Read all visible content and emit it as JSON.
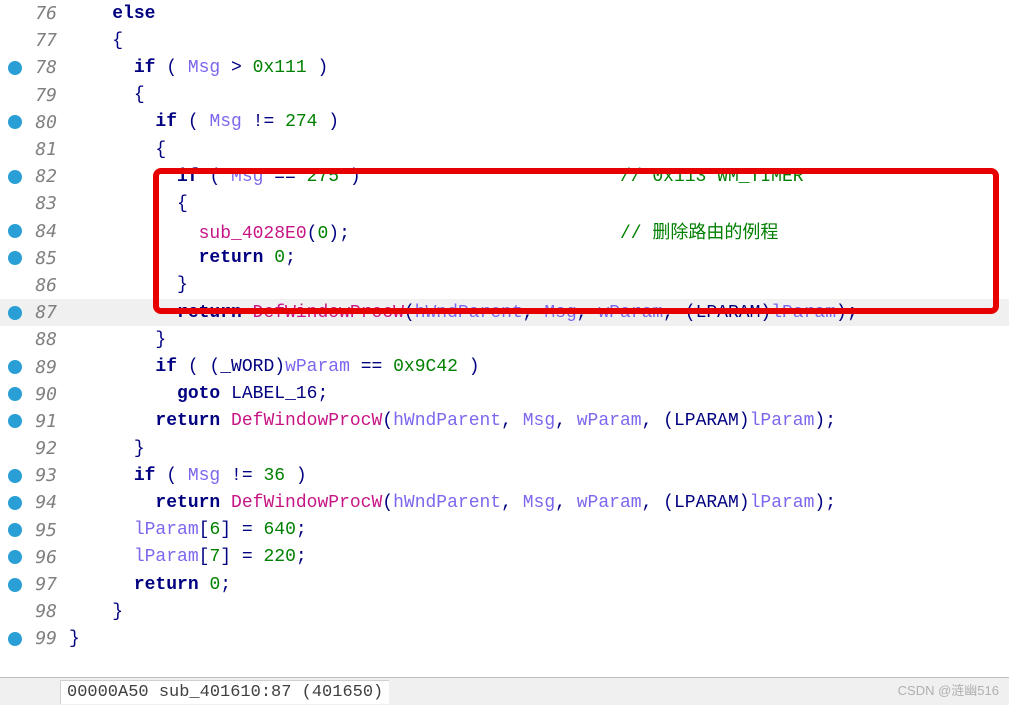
{
  "status": "00000A50 sub_401610:87 (401650)",
  "watermark": "CSDN @涟幽516",
  "lines": [
    {
      "num": "76",
      "bp": false,
      "hl": false,
      "segs": [
        {
          "t": "    ",
          "c": ""
        },
        {
          "t": "else",
          "c": "kw"
        }
      ]
    },
    {
      "num": "77",
      "bp": false,
      "hl": false,
      "segs": [
        {
          "t": "    ",
          "c": ""
        },
        {
          "t": "{",
          "c": "punct"
        }
      ]
    },
    {
      "num": "78",
      "bp": true,
      "hl": false,
      "segs": [
        {
          "t": "      ",
          "c": ""
        },
        {
          "t": "if",
          "c": "kw"
        },
        {
          "t": " ( ",
          "c": ""
        },
        {
          "t": "Msg",
          "c": "var"
        },
        {
          "t": " > ",
          "c": ""
        },
        {
          "t": "0x111",
          "c": "num"
        },
        {
          "t": " )",
          "c": ""
        }
      ]
    },
    {
      "num": "79",
      "bp": false,
      "hl": false,
      "segs": [
        {
          "t": "      ",
          "c": ""
        },
        {
          "t": "{",
          "c": "punct"
        }
      ]
    },
    {
      "num": "80",
      "bp": true,
      "hl": false,
      "segs": [
        {
          "t": "        ",
          "c": ""
        },
        {
          "t": "if",
          "c": "kw"
        },
        {
          "t": " ( ",
          "c": ""
        },
        {
          "t": "Msg",
          "c": "var"
        },
        {
          "t": " != ",
          "c": ""
        },
        {
          "t": "274",
          "c": "num"
        },
        {
          "t": " )",
          "c": ""
        }
      ]
    },
    {
      "num": "81",
      "bp": false,
      "hl": false,
      "segs": [
        {
          "t": "        ",
          "c": ""
        },
        {
          "t": "{",
          "c": "punct"
        }
      ]
    },
    {
      "num": "82",
      "bp": true,
      "hl": false,
      "segs": [
        {
          "t": "          ",
          "c": ""
        },
        {
          "t": "if",
          "c": "kw"
        },
        {
          "t": " ( ",
          "c": ""
        },
        {
          "t": "Msg",
          "c": "var"
        },
        {
          "t": " == ",
          "c": ""
        },
        {
          "t": "275",
          "c": "num"
        },
        {
          "t": " )                        ",
          "c": ""
        },
        {
          "t": "// 0x113 WM_TIMER",
          "c": "comment"
        }
      ]
    },
    {
      "num": "83",
      "bp": false,
      "hl": false,
      "segs": [
        {
          "t": "          ",
          "c": ""
        },
        {
          "t": "{",
          "c": "punct"
        }
      ]
    },
    {
      "num": "84",
      "bp": true,
      "hl": false,
      "segs": [
        {
          "t": "            ",
          "c": ""
        },
        {
          "t": "sub_4028E0",
          "c": "func"
        },
        {
          "t": "(",
          "c": ""
        },
        {
          "t": "0",
          "c": "num"
        },
        {
          "t": ");                         ",
          "c": ""
        },
        {
          "t": "// 删除路由的例程",
          "c": "comment"
        }
      ]
    },
    {
      "num": "85",
      "bp": true,
      "hl": false,
      "segs": [
        {
          "t": "            ",
          "c": ""
        },
        {
          "t": "return",
          "c": "kw"
        },
        {
          "t": " ",
          "c": ""
        },
        {
          "t": "0",
          "c": "num"
        },
        {
          "t": ";",
          "c": ""
        }
      ]
    },
    {
      "num": "86",
      "bp": false,
      "hl": false,
      "segs": [
        {
          "t": "          ",
          "c": ""
        },
        {
          "t": "}",
          "c": "punct"
        }
      ]
    },
    {
      "num": "87",
      "bp": true,
      "hl": true,
      "segs": [
        {
          "t": "          ",
          "c": ""
        },
        {
          "t": "return",
          "c": "kw"
        },
        {
          "t": " ",
          "c": ""
        },
        {
          "t": "DefWindowProcW",
          "c": "func"
        },
        {
          "t": "(",
          "c": ""
        },
        {
          "t": "hWndParent",
          "c": "var"
        },
        {
          "t": ", ",
          "c": ""
        },
        {
          "t": "Msg",
          "c": "var"
        },
        {
          "t": ", ",
          "c": ""
        },
        {
          "t": "wParam",
          "c": "var"
        },
        {
          "t": ", (",
          "c": ""
        },
        {
          "t": "LPARAM",
          "c": "type"
        },
        {
          "t": ")",
          "c": ""
        },
        {
          "t": "lParam",
          "c": "var"
        },
        {
          "t": ");",
          "c": ""
        }
      ]
    },
    {
      "num": "88",
      "bp": false,
      "hl": false,
      "segs": [
        {
          "t": "        ",
          "c": ""
        },
        {
          "t": "}",
          "c": "punct"
        }
      ]
    },
    {
      "num": "89",
      "bp": true,
      "hl": false,
      "segs": [
        {
          "t": "        ",
          "c": ""
        },
        {
          "t": "if",
          "c": "kw"
        },
        {
          "t": " ( (",
          "c": ""
        },
        {
          "t": "_WORD",
          "c": "type"
        },
        {
          "t": ")",
          "c": ""
        },
        {
          "t": "wParam",
          "c": "var"
        },
        {
          "t": " == ",
          "c": ""
        },
        {
          "t": "0x9C42",
          "c": "num"
        },
        {
          "t": " )",
          "c": ""
        }
      ]
    },
    {
      "num": "90",
      "bp": true,
      "hl": false,
      "segs": [
        {
          "t": "          ",
          "c": ""
        },
        {
          "t": "goto",
          "c": "kw"
        },
        {
          "t": " ",
          "c": ""
        },
        {
          "t": "LABEL_16",
          "c": "punct"
        },
        {
          "t": ";",
          "c": ""
        }
      ]
    },
    {
      "num": "91",
      "bp": true,
      "hl": false,
      "segs": [
        {
          "t": "        ",
          "c": ""
        },
        {
          "t": "return",
          "c": "kw"
        },
        {
          "t": " ",
          "c": ""
        },
        {
          "t": "DefWindowProcW",
          "c": "func"
        },
        {
          "t": "(",
          "c": ""
        },
        {
          "t": "hWndParent",
          "c": "var"
        },
        {
          "t": ", ",
          "c": ""
        },
        {
          "t": "Msg",
          "c": "var"
        },
        {
          "t": ", ",
          "c": ""
        },
        {
          "t": "wParam",
          "c": "var"
        },
        {
          "t": ", (",
          "c": ""
        },
        {
          "t": "LPARAM",
          "c": "type"
        },
        {
          "t": ")",
          "c": ""
        },
        {
          "t": "lParam",
          "c": "var"
        },
        {
          "t": ");",
          "c": ""
        }
      ]
    },
    {
      "num": "92",
      "bp": false,
      "hl": false,
      "segs": [
        {
          "t": "      ",
          "c": ""
        },
        {
          "t": "}",
          "c": "punct"
        }
      ]
    },
    {
      "num": "93",
      "bp": true,
      "hl": false,
      "segs": [
        {
          "t": "      ",
          "c": ""
        },
        {
          "t": "if",
          "c": "kw"
        },
        {
          "t": " ( ",
          "c": ""
        },
        {
          "t": "Msg",
          "c": "var"
        },
        {
          "t": " != ",
          "c": ""
        },
        {
          "t": "36",
          "c": "num"
        },
        {
          "t": " )",
          "c": ""
        }
      ]
    },
    {
      "num": "94",
      "bp": true,
      "hl": false,
      "segs": [
        {
          "t": "        ",
          "c": ""
        },
        {
          "t": "return",
          "c": "kw"
        },
        {
          "t": " ",
          "c": ""
        },
        {
          "t": "DefWindowProcW",
          "c": "func"
        },
        {
          "t": "(",
          "c": ""
        },
        {
          "t": "hWndParent",
          "c": "var"
        },
        {
          "t": ", ",
          "c": ""
        },
        {
          "t": "Msg",
          "c": "var"
        },
        {
          "t": ", ",
          "c": ""
        },
        {
          "t": "wParam",
          "c": "var"
        },
        {
          "t": ", (",
          "c": ""
        },
        {
          "t": "LPARAM",
          "c": "type"
        },
        {
          "t": ")",
          "c": ""
        },
        {
          "t": "lParam",
          "c": "var"
        },
        {
          "t": ");",
          "c": ""
        }
      ]
    },
    {
      "num": "95",
      "bp": true,
      "hl": false,
      "segs": [
        {
          "t": "      ",
          "c": ""
        },
        {
          "t": "lParam",
          "c": "var"
        },
        {
          "t": "[",
          "c": ""
        },
        {
          "t": "6",
          "c": "num"
        },
        {
          "t": "] = ",
          "c": ""
        },
        {
          "t": "640",
          "c": "num"
        },
        {
          "t": ";",
          "c": ""
        }
      ]
    },
    {
      "num": "96",
      "bp": true,
      "hl": false,
      "segs": [
        {
          "t": "      ",
          "c": ""
        },
        {
          "t": "lParam",
          "c": "var"
        },
        {
          "t": "[",
          "c": ""
        },
        {
          "t": "7",
          "c": "num"
        },
        {
          "t": "] = ",
          "c": ""
        },
        {
          "t": "220",
          "c": "num"
        },
        {
          "t": ";",
          "c": ""
        }
      ]
    },
    {
      "num": "97",
      "bp": true,
      "hl": false,
      "segs": [
        {
          "t": "      ",
          "c": ""
        },
        {
          "t": "return",
          "c": "kw"
        },
        {
          "t": " ",
          "c": ""
        },
        {
          "t": "0",
          "c": "num"
        },
        {
          "t": ";",
          "c": ""
        }
      ]
    },
    {
      "num": "98",
      "bp": false,
      "hl": false,
      "segs": [
        {
          "t": "    ",
          "c": ""
        },
        {
          "t": "}",
          "c": "punct"
        }
      ]
    },
    {
      "num": "99",
      "bp": true,
      "hl": false,
      "segs": [
        {
          "t": "",
          "c": ""
        },
        {
          "t": "}",
          "c": "punct"
        }
      ]
    }
  ]
}
